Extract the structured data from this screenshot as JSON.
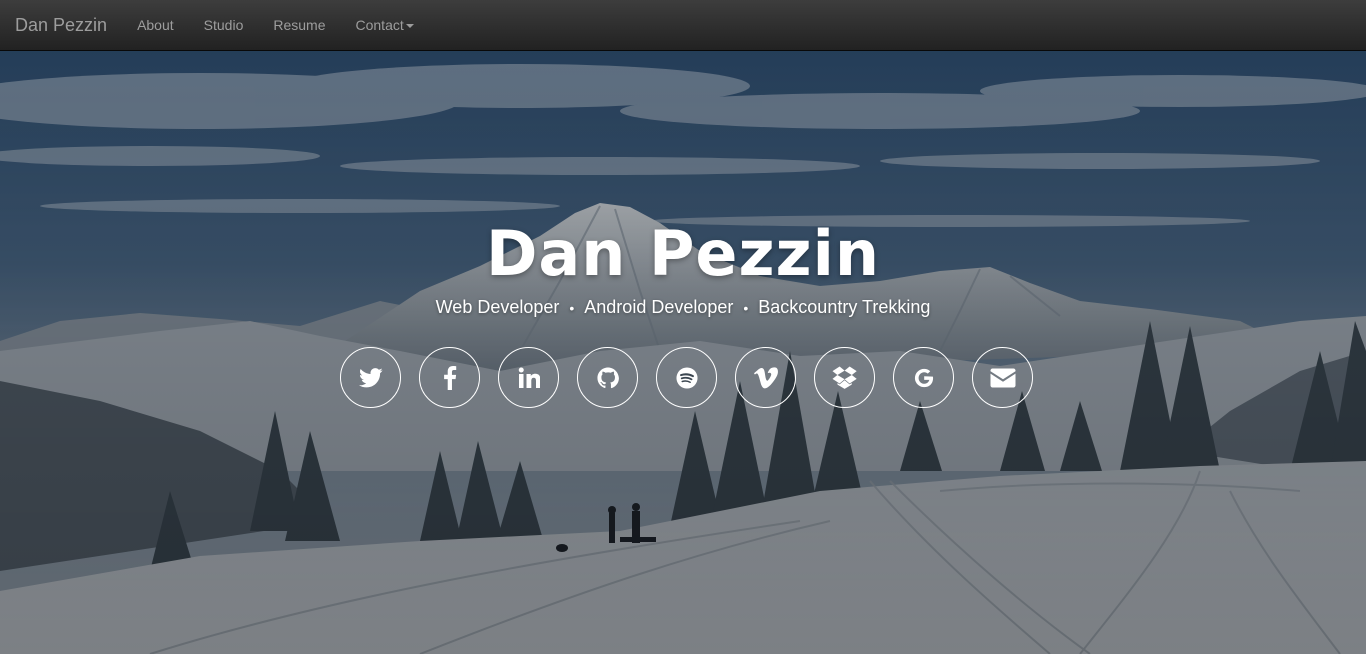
{
  "navbar": {
    "brand": "Dan Pezzin",
    "items": [
      {
        "label": "About"
      },
      {
        "label": "Studio"
      },
      {
        "label": "Resume"
      },
      {
        "label": "Contact",
        "has_dropdown": true
      }
    ]
  },
  "hero": {
    "title": "Dan Pezzin",
    "tagline": [
      "Web Developer",
      "Android Developer",
      "Backcountry Trekking"
    ],
    "separator": "•",
    "social_links": [
      {
        "icon": "twitter-icon"
      },
      {
        "icon": "facebook-icon"
      },
      {
        "icon": "linkedin-icon"
      },
      {
        "icon": "github-icon"
      },
      {
        "icon": "spotify-icon"
      },
      {
        "icon": "vimeo-icon"
      },
      {
        "icon": "dropbox-icon"
      },
      {
        "icon": "google-icon"
      },
      {
        "icon": "email-icon"
      }
    ]
  },
  "colors": {
    "navbar_bg": "#222222",
    "nav_text": "#9d9d9d",
    "hero_text": "#ffffff"
  }
}
